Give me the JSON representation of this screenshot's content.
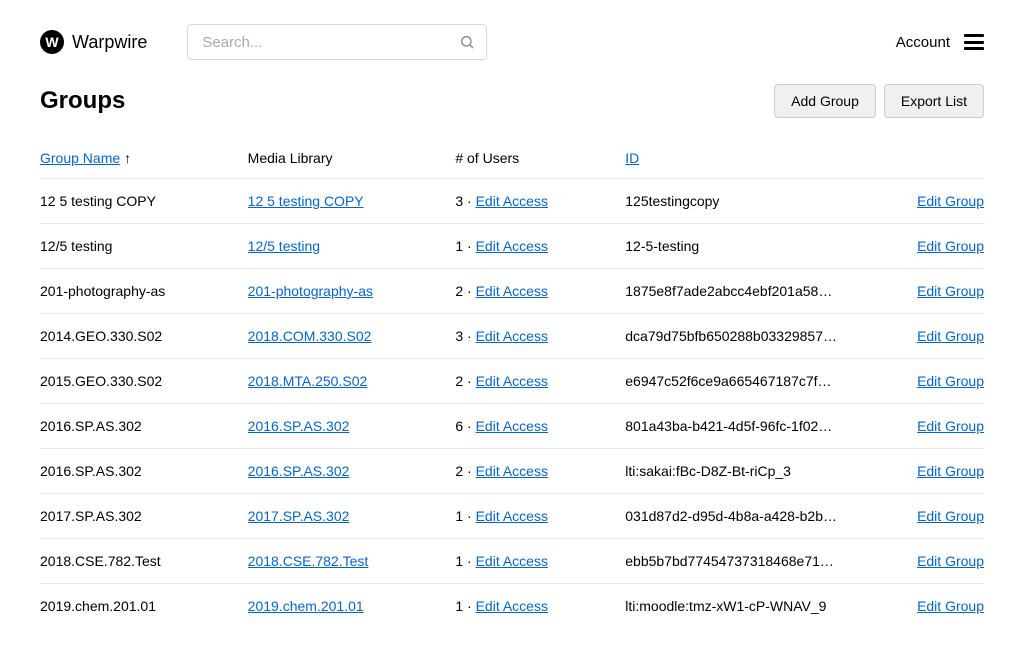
{
  "header": {
    "brand": "Warpwire",
    "search_placeholder": "Search...",
    "account_label": "Account"
  },
  "page": {
    "title": "Groups",
    "add_group_label": "Add Group",
    "export_list_label": "Export List"
  },
  "columns": {
    "group_name": "Group Name",
    "media_library": "Media Library",
    "users": "# of Users",
    "id": "ID",
    "sort_indicator": "↑"
  },
  "labels": {
    "edit_access": "Edit Access",
    "edit_group": "Edit Group",
    "dot_sep": " · "
  },
  "rows": [
    {
      "name": "12 5 testing COPY",
      "library": "12 5 testing COPY",
      "users": 3,
      "id": "125testingcopy"
    },
    {
      "name": "12/5 testing",
      "library": "12/5 testing",
      "users": 1,
      "id": "12-5-testing"
    },
    {
      "name": "201-photography-as",
      "library": "201-photography-as",
      "users": 2,
      "id": "1875e8f7ade2abcc4ebf201a58…"
    },
    {
      "name": "2014.GEO.330.S02",
      "library": "2018.COM.330.S02",
      "users": 3,
      "id": "dca79d75bfb650288b03329857…"
    },
    {
      "name": "2015.GEO.330.S02",
      "library": "2018.MTA.250.S02",
      "users": 2,
      "id": "e6947c52f6ce9a665467187c7f…"
    },
    {
      "name": "2016.SP.AS.302",
      "library": "2016.SP.AS.302",
      "users": 6,
      "id": "801a43ba-b421-4d5f-96fc-1f02…"
    },
    {
      "name": "2016.SP.AS.302",
      "library": "2016.SP.AS.302",
      "users": 2,
      "id": "lti:sakai:fBc-D8Z-Bt-riCp_3"
    },
    {
      "name": "2017.SP.AS.302",
      "library": "2017.SP.AS.302",
      "users": 1,
      "id": "031d87d2-d95d-4b8a-a428-b2b…"
    },
    {
      "name": "2018.CSE.782.Test",
      "library": "2018.CSE.782.Test",
      "users": 1,
      "id": "ebb5b7bd77454737318468e71…"
    },
    {
      "name": "2019.chem.201.01",
      "library": "2019.chem.201.01",
      "users": 1,
      "id": "lti:moodle:tmz-xW1-cP-WNAV_9"
    }
  ]
}
